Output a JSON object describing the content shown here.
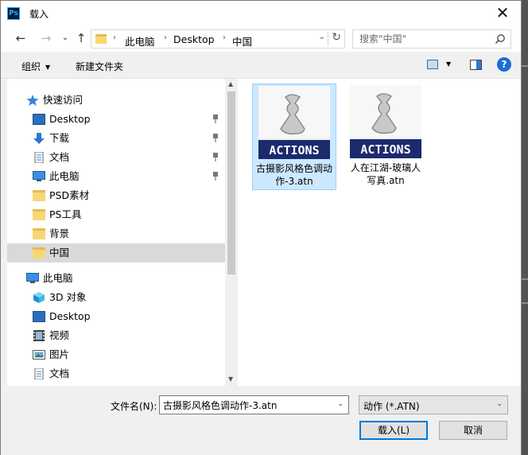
{
  "title": "载入",
  "app_icon_text": "Ps",
  "address": {
    "crumbs": [
      "此电脑",
      "Desktop",
      "中国"
    ]
  },
  "search": {
    "placeholder": "搜索\"中国\""
  },
  "toolbar": {
    "organize": "组织",
    "new_folder": "新建文件夹",
    "help": "?"
  },
  "nav": {
    "quick_access": "快速访问",
    "quick_items": [
      {
        "label": "Desktop",
        "icon": "desktop-icon",
        "pinned": true
      },
      {
        "label": "下载",
        "icon": "download-icon",
        "pinned": true
      },
      {
        "label": "文档",
        "icon": "document-icon",
        "pinned": true
      },
      {
        "label": "此电脑",
        "icon": "computer-icon",
        "pinned": true
      },
      {
        "label": "PSD素材",
        "icon": "folder-icon",
        "pinned": false
      },
      {
        "label": "PS工具",
        "icon": "folder-icon",
        "pinned": false
      },
      {
        "label": "背景",
        "icon": "folder-icon",
        "pinned": false
      },
      {
        "label": "中国",
        "icon": "folder-icon",
        "pinned": false,
        "selected": true
      }
    ],
    "this_pc": "此电脑",
    "pc_items": [
      {
        "label": "3D 对象",
        "icon": "3d-objects-icon"
      },
      {
        "label": "Desktop",
        "icon": "desktop-icon"
      },
      {
        "label": "视频",
        "icon": "video-icon"
      },
      {
        "label": "图片",
        "icon": "pictures-icon"
      },
      {
        "label": "文档",
        "icon": "document-icon"
      }
    ]
  },
  "files": [
    {
      "icon_text": "ACTIONS",
      "name": "古摄影风格色调动作-3.atn",
      "selected": true
    },
    {
      "icon_text": "ACTIONS",
      "name": "人在江湖-玻璃人写真.atn",
      "selected": false
    }
  ],
  "bottom": {
    "filename_label": "文件名(N):",
    "filename_value": "古摄影风格色调动作-3.atn",
    "filetype": "动作 (*.ATN)",
    "open": "载入(L)",
    "cancel": "取消"
  },
  "colors": {
    "accent": "#0078d7",
    "selection": "#cce8ff",
    "actions_banner": "#1c2a6e"
  }
}
